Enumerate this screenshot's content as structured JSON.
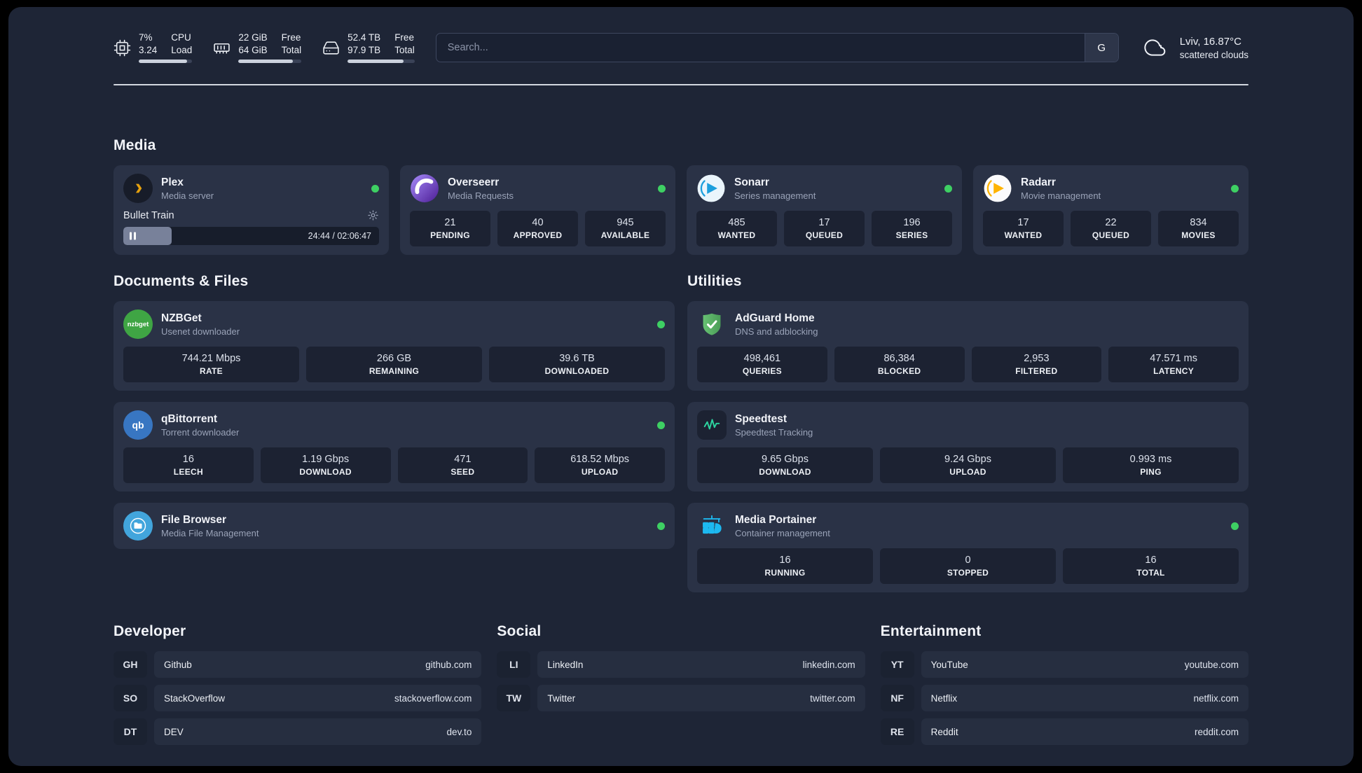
{
  "colors": {
    "status_online": "#3ed063",
    "plex_brand": "#e5a00d",
    "adguard_green": "#5fba6f",
    "portainer_blue": "#1db9f0"
  },
  "topbar": {
    "cpu": {
      "value1": "7%",
      "value2": "3.24",
      "label1": "CPU",
      "label2": "Load",
      "bar": 90
    },
    "ram": {
      "value1": "22 GiB",
      "value2": "64 GiB",
      "label1": "Free",
      "label2": "Total",
      "bar": 87
    },
    "disk": {
      "value1": "52.4 TB",
      "value2": "97.9 TB",
      "label1": "Free",
      "label2": "Total",
      "bar": 84
    },
    "search": {
      "placeholder": "Search...",
      "engine_label": "G"
    },
    "weather": {
      "location": "Lviv, 16.87°C",
      "condition": "scattered clouds"
    }
  },
  "media": {
    "title": "Media",
    "plex": {
      "name": "Plex",
      "subtitle": "Media server",
      "now_playing": "Bullet Train",
      "time": "24:44 / 02:06:47",
      "progress": 19
    },
    "overseerr": {
      "name": "Overseerr",
      "subtitle": "Media Requests",
      "stats": [
        {
          "value": "21",
          "label": "PENDING"
        },
        {
          "value": "40",
          "label": "APPROVED"
        },
        {
          "value": "945",
          "label": "AVAILABLE"
        }
      ]
    },
    "sonarr": {
      "name": "Sonarr",
      "subtitle": "Series management",
      "stats": [
        {
          "value": "485",
          "label": "WANTED"
        },
        {
          "value": "17",
          "label": "QUEUED"
        },
        {
          "value": "196",
          "label": "SERIES"
        }
      ]
    },
    "radarr": {
      "name": "Radarr",
      "subtitle": "Movie management",
      "stats": [
        {
          "value": "17",
          "label": "WANTED"
        },
        {
          "value": "22",
          "label": "QUEUED"
        },
        {
          "value": "834",
          "label": "MOVIES"
        }
      ]
    }
  },
  "documents": {
    "title": "Documents & Files",
    "nzbget": {
      "name": "NZBGet",
      "subtitle": "Usenet downloader",
      "icon_label": "nzbget",
      "stats": [
        {
          "value": "744.21 Mbps",
          "label": "RATE"
        },
        {
          "value": "266 GB",
          "label": "REMAINING"
        },
        {
          "value": "39.6 TB",
          "label": "DOWNLOADED"
        }
      ]
    },
    "qbittorrent": {
      "name": "qBittorrent",
      "subtitle": "Torrent downloader",
      "icon_label": "qb",
      "stats": [
        {
          "value": "16",
          "label": "LEECH"
        },
        {
          "value": "1.19 Gbps",
          "label": "DOWNLOAD"
        },
        {
          "value": "471",
          "label": "SEED"
        },
        {
          "value": "618.52 Mbps",
          "label": "UPLOAD"
        }
      ]
    },
    "filebrowser": {
      "name": "File Browser",
      "subtitle": "Media File Management"
    }
  },
  "utilities": {
    "title": "Utilities",
    "adguard": {
      "name": "AdGuard Home",
      "subtitle": "DNS and adblocking",
      "stats": [
        {
          "value": "498,461",
          "label": "QUERIES"
        },
        {
          "value": "86,384",
          "label": "BLOCKED"
        },
        {
          "value": "2,953",
          "label": "FILTERED"
        },
        {
          "value": "47.571 ms",
          "label": "LATENCY"
        }
      ]
    },
    "speedtest": {
      "name": "Speedtest",
      "subtitle": "Speedtest Tracking",
      "stats": [
        {
          "value": "9.65 Gbps",
          "label": "DOWNLOAD"
        },
        {
          "value": "9.24 Gbps",
          "label": "UPLOAD"
        },
        {
          "value": "0.993 ms",
          "label": "PING"
        }
      ]
    },
    "portainer": {
      "name": "Media Portainer",
      "subtitle": "Container management",
      "stats": [
        {
          "value": "16",
          "label": "RUNNING"
        },
        {
          "value": "0",
          "label": "STOPPED"
        },
        {
          "value": "16",
          "label": "TOTAL"
        }
      ]
    }
  },
  "bookmarks": {
    "developer": {
      "title": "Developer",
      "items": [
        {
          "abbr": "GH",
          "name": "Github",
          "url": "github.com"
        },
        {
          "abbr": "SO",
          "name": "StackOverflow",
          "url": "stackoverflow.com"
        },
        {
          "abbr": "DT",
          "name": "DEV",
          "url": "dev.to"
        }
      ]
    },
    "social": {
      "title": "Social",
      "items": [
        {
          "abbr": "LI",
          "name": "LinkedIn",
          "url": "linkedin.com"
        },
        {
          "abbr": "TW",
          "name": "Twitter",
          "url": "twitter.com"
        }
      ]
    },
    "entertainment": {
      "title": "Entertainment",
      "items": [
        {
          "abbr": "YT",
          "name": "YouTube",
          "url": "youtube.com"
        },
        {
          "abbr": "NF",
          "name": "Netflix",
          "url": "netflix.com"
        },
        {
          "abbr": "RE",
          "name": "Reddit",
          "url": "reddit.com"
        }
      ]
    }
  }
}
